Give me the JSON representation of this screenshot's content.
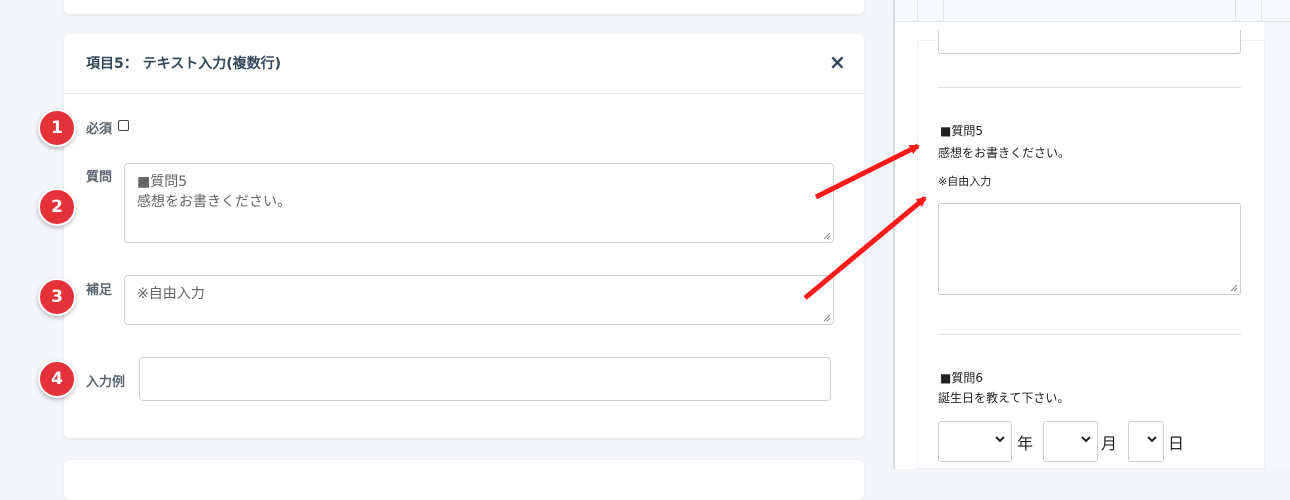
{
  "editor": {
    "item_title": "項目5： テキスト入力(複数行)",
    "close_symbol": "×",
    "required_label": "必須",
    "question_label": "質問",
    "question_lines": [
      "■質問5",
      "感想をお書きください。"
    ],
    "supplement_label": "補足",
    "supplement_value": "※自由入力",
    "example_label": "入力例",
    "example_value": ""
  },
  "badges": [
    "1",
    "2",
    "3",
    "4"
  ],
  "preview": {
    "q5_title": "■質問5",
    "q5_text": "感想をお書きください。",
    "q5_note": "※自由入力",
    "q6_title": "■質問6",
    "q6_text": "誕生日を教えて下さい。",
    "year_unit": "年",
    "month_unit": "月",
    "day_unit": "日"
  },
  "colors": {
    "badge": "#e53238",
    "arrow": "#ff1a1a",
    "title": "#34465a"
  }
}
